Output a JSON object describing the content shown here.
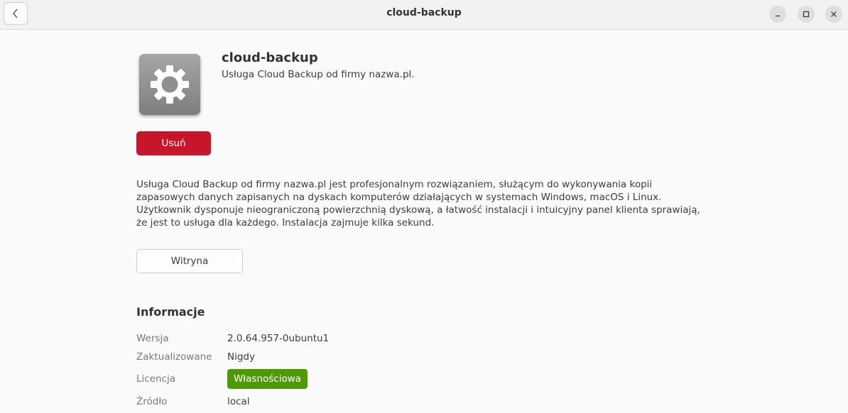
{
  "window": {
    "title": "cloud-backup"
  },
  "app": {
    "name": "cloud-backup",
    "summary": "Usługa Cloud Backup od firmy nazwa.pl.",
    "icon": "gear-icon",
    "remove_label": "Usuń",
    "description": "Usługa Cloud Backup od firmy nazwa.pl jest profesjonalnym rozwiązaniem, służącym do wykonywania kopii zapasowych danych zapisanych na dyskach komputerów działających w systemach Windows, macOS i Linux. Użytkownik dysponuje nieograniczoną powierzchnią dyskową, a łatwość instalacji i intuicyjny panel klienta sprawiają, że jest to usługa dla każdego. Instalacja zajmuje kilka sekund.",
    "website_label": "Witryna"
  },
  "info": {
    "heading": "Informacje",
    "version_label": "Wersja",
    "version_value": "2.0.64.957-0ubuntu1",
    "updated_label": "Zaktualizowane",
    "updated_value": "Nigdy",
    "license_label": "Licencja",
    "license_value": "Własnościowa",
    "source_label": "Źródło",
    "source_value": "local"
  },
  "colors": {
    "remove_button": "#c7162b",
    "license_badge": "#4e9a06"
  }
}
